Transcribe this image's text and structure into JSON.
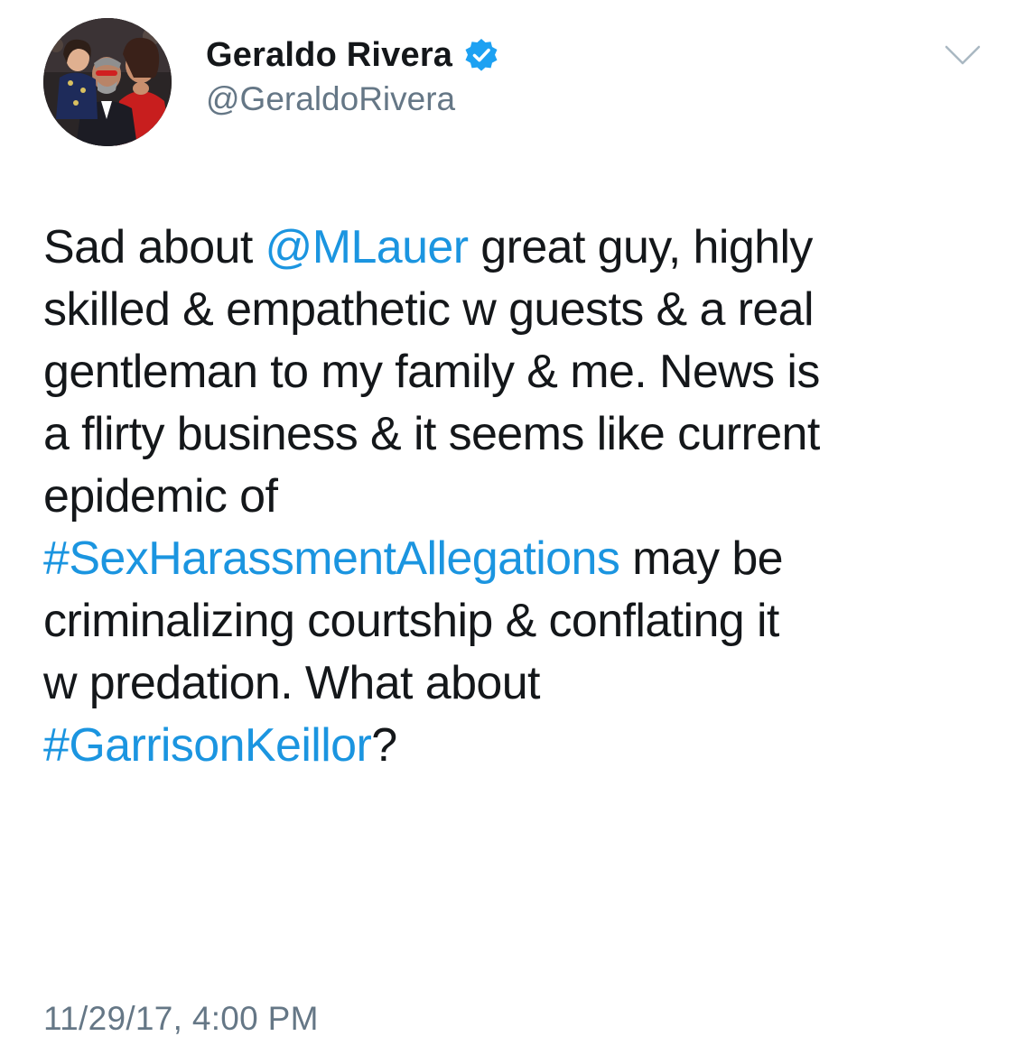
{
  "author": {
    "display_name": "Geraldo Rivera",
    "handle": "@GeraldoRivera",
    "verified": true
  },
  "icons": {
    "verified": "verified-badge-icon",
    "more": "chevron-down-icon"
  },
  "colors": {
    "link": "#1b95e0",
    "text": "#14171a",
    "secondary": "#657786",
    "verified": "#1da1f2"
  },
  "tweet": {
    "lines": [
      [
        {
          "text": "Sad about ",
          "type": "text"
        },
        {
          "text": "@MLauer",
          "type": "mention"
        },
        {
          "text": " great guy, highly",
          "type": "text"
        }
      ],
      [
        {
          "text": "skilled & empathetic w guests & a real",
          "type": "text"
        }
      ],
      [
        {
          "text": "gentleman to my family & me. News is",
          "type": "text"
        }
      ],
      [
        {
          "text": "a flirty business & it seems like current",
          "type": "text"
        }
      ],
      [
        {
          "text": "epidemic of",
          "type": "text"
        }
      ],
      [
        {
          "text": "#SexHarassmentAllegations",
          "type": "hashtag"
        },
        {
          "text": " may be",
          "type": "text"
        }
      ],
      [
        {
          "text": "criminalizing courtship & conflating it",
          "type": "text"
        }
      ],
      [
        {
          "text": "w predation. What about",
          "type": "text"
        }
      ],
      [
        {
          "text": "#GarrisonKeillor",
          "type": "hashtag"
        },
        {
          "text": "?",
          "type": "text"
        }
      ]
    ],
    "timestamp": "11/29/17, 4:00 PM"
  }
}
